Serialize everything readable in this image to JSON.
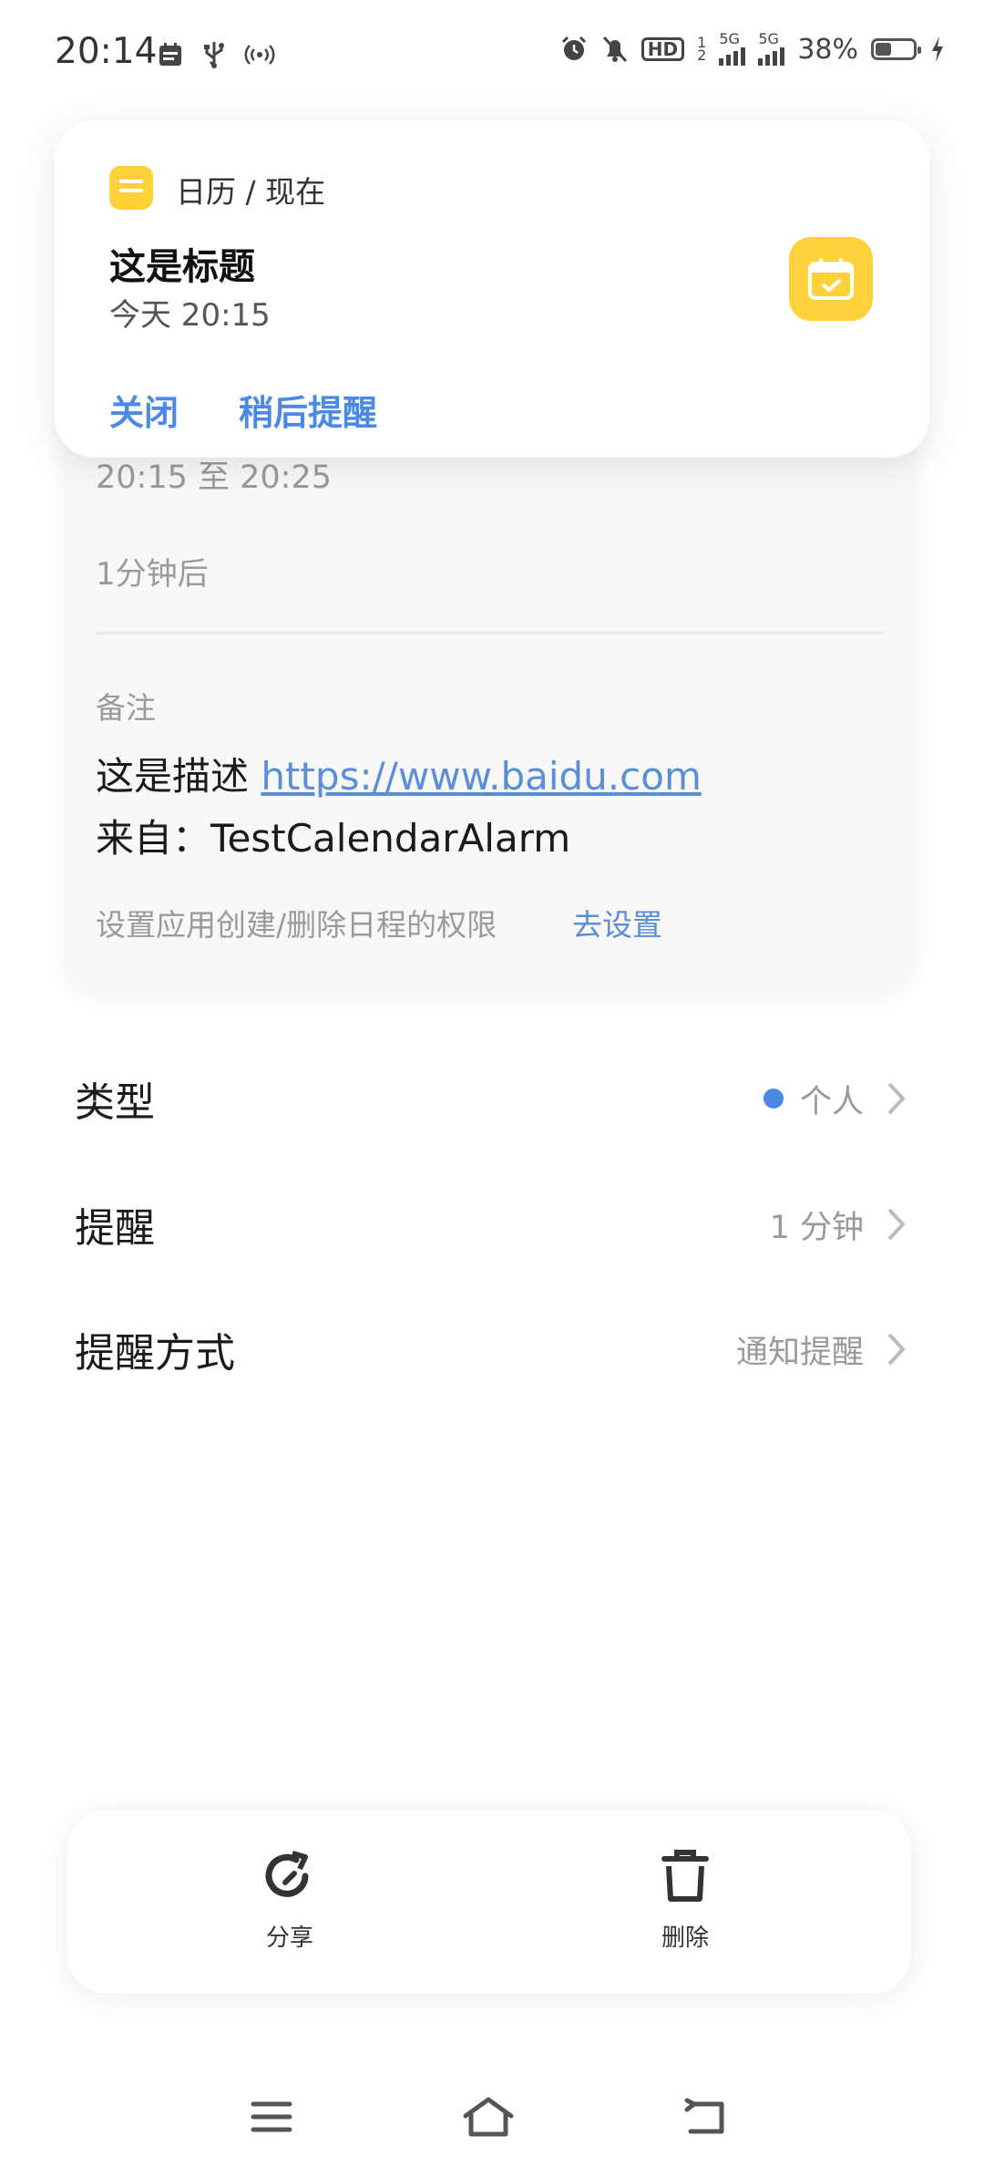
{
  "status_bar": {
    "time": "20:14",
    "battery": "38%",
    "network_1": "5G",
    "network_2": "5G",
    "hd": "HD",
    "hd_sub": "1",
    "hd_sub2": "2"
  },
  "notification": {
    "app_name": "日历 / 现在",
    "title": "这是标题",
    "subtitle": "今天 20:15",
    "close_label": "关闭",
    "later_label": "稍后提醒",
    "accent": "#ffd23c"
  },
  "details": {
    "time_range": "20:15 至 20:25",
    "reminder": "1分钟后",
    "note_label": "备注",
    "desc_prefix": "这是描述 ",
    "desc_link": "https://www.baidu.com",
    "source_line": "来自：TestCalendarAlarm",
    "perm_text": "设置应用创建/删除日程的权限",
    "perm_link": "去设置"
  },
  "rows": [
    {
      "label": "类型",
      "value": "个人"
    },
    {
      "label": "提醒",
      "value": "1 分钟"
    },
    {
      "label": "提醒方式",
      "value": "通知提醒"
    }
  ],
  "actions": {
    "share_label": "分享",
    "delete_label": "删除"
  },
  "colors": {
    "link": "#5a8fd8",
    "type_dot": "#4a8ae6"
  }
}
